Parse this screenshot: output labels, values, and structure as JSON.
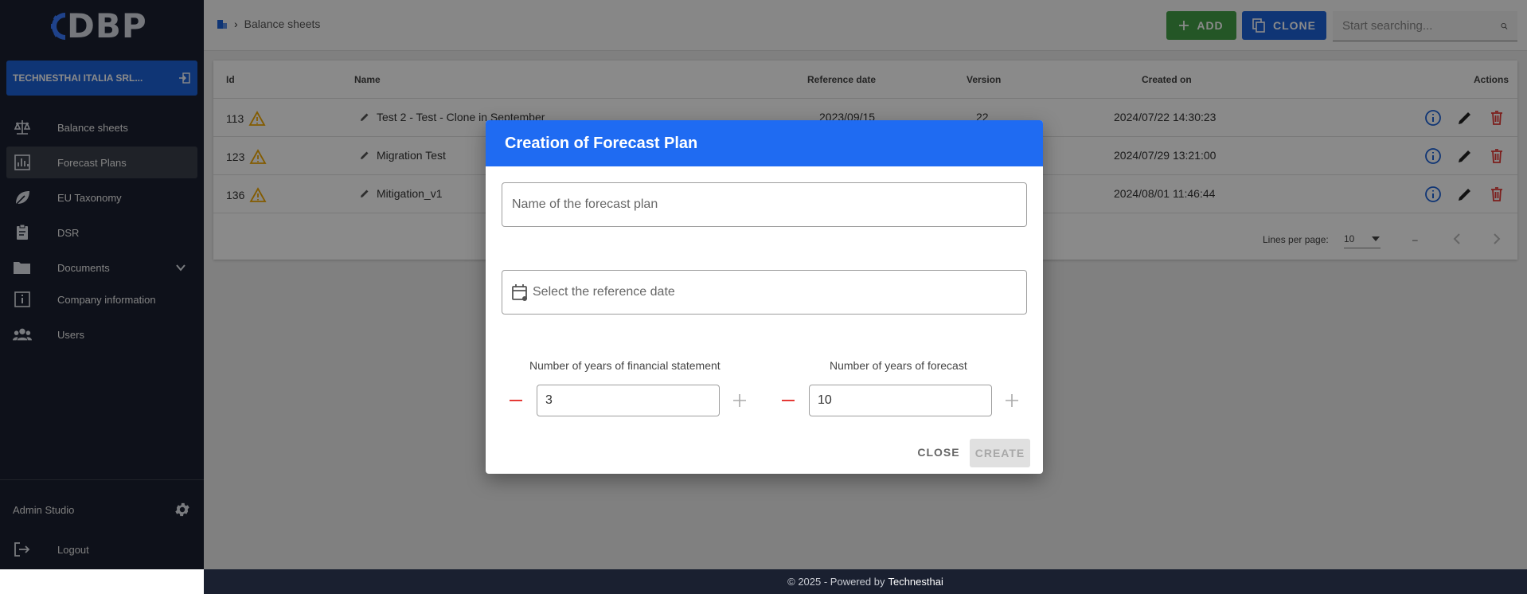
{
  "sidebar": {
    "logo_text": "DBP",
    "company": "TECHNESTHAI ITALIA SRL...",
    "items": [
      {
        "label": "Balance sheets",
        "icon": "scale-icon"
      },
      {
        "label": "Forecast Plans",
        "icon": "chart-icon"
      },
      {
        "label": "EU Taxonomy",
        "icon": "leaf-icon"
      },
      {
        "label": "DSR",
        "icon": "clipboard-icon"
      },
      {
        "label": "Documents",
        "icon": "folder-icon"
      },
      {
        "label": "Company information",
        "icon": "info-box-icon"
      },
      {
        "label": "Users",
        "icon": "users-icon"
      }
    ],
    "active_index": 1,
    "admin_label": "Admin Studio",
    "logout_label": "Logout"
  },
  "header": {
    "breadcrumb": "Balance sheets",
    "add_label": "ADD",
    "clone_label": "CLONE",
    "search_placeholder": "Start searching..."
  },
  "table": {
    "columns": [
      "Id",
      "Name",
      "Reference date",
      "Version",
      "Created on",
      "Actions"
    ],
    "rows": [
      {
        "id": "113",
        "name": "Test 2 - Test - Clone in September",
        "ref_date": "2023/09/15",
        "version": "22",
        "created": "2024/07/22 14:30:23"
      },
      {
        "id": "123",
        "name": "Migration Test",
        "ref_date": "",
        "version": "",
        "created": "2024/07/29 13:21:00"
      },
      {
        "id": "136",
        "name": "Mitigation_v1",
        "ref_date": "",
        "version": "",
        "created": "2024/08/01 11:46:44"
      }
    ],
    "lines_per_page_label": "Lines per page:",
    "lines_per_page": "10",
    "range": "–"
  },
  "footer": {
    "text": "© 2025 - Powered by",
    "brand": "Technesthai"
  },
  "dialog": {
    "title": "Creation of Forecast Plan",
    "name_placeholder": "Name of the forecast plan",
    "date_placeholder": "Select the reference date",
    "fs_years_label": "Number of years of financial statement",
    "fs_years_value": "3",
    "forecast_years_label": "Number of years of forecast",
    "forecast_years_value": "10",
    "close_label": "CLOSE",
    "create_label": "CREATE"
  },
  "colors": {
    "sidebar_bg": "#1a2030",
    "primary": "#1f6bf2",
    "add_green": "#43a047",
    "danger": "#e53935",
    "warning": "#f2a900"
  }
}
